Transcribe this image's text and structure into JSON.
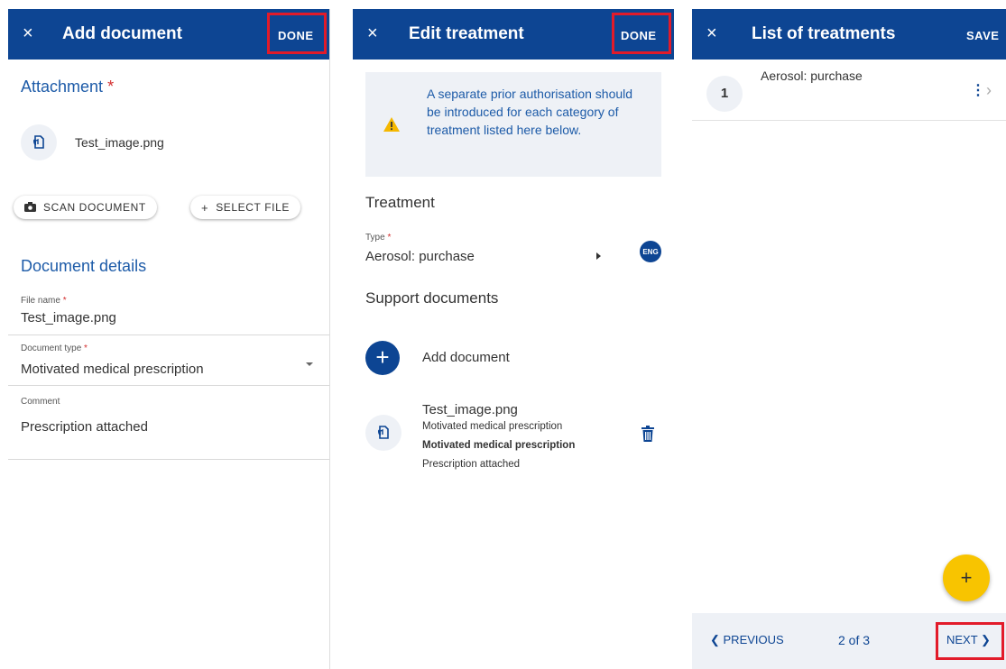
{
  "panel_add_document": {
    "title": "Add document",
    "done": "DONE",
    "attachment_heading": "Attachment",
    "required_mark": "*",
    "file_name": "Test_image.png",
    "scan_button": "SCAN DOCUMENT",
    "select_file_button": "SELECT FILE",
    "select_file_icon": "+",
    "details_heading": "Document details",
    "fields": {
      "file_name_label": "File name",
      "file_name_value": "Test_image.png",
      "document_type_label": "Document type",
      "document_type_value": "Motivated medical prescription",
      "comment_label": "Comment",
      "comment_value": "Prescription attached"
    }
  },
  "panel_edit_treatment": {
    "title": "Edit treatment",
    "done": "DONE",
    "warning": "A separate prior authorisation should be introduced for each category of treatment listed here below.",
    "treatment_heading": "Treatment",
    "type_label": "Type",
    "type_value": "Aerosol: purchase",
    "language_badge": "ENG",
    "support_heading": "Support documents",
    "add_document": "Add document",
    "add_icon": "+",
    "document": {
      "name": "Test_image.png",
      "line1": "Motivated medical prescription",
      "line2": "Motivated medical prescription",
      "line3": "Prescription attached"
    }
  },
  "panel_list_treatments": {
    "title": "List of treatments",
    "save": "SAVE",
    "items": [
      {
        "number": "1",
        "label": "Aerosol: purchase"
      }
    ],
    "kebab": "⋮",
    "chevron": "›",
    "fab": "+",
    "pagination": {
      "previous": "❮ PREVIOUS",
      "page": "2 of 3",
      "next": "NEXT ❯"
    }
  },
  "close_glyph": "×",
  "icons": {
    "close": "close-icon",
    "camera": "camera-icon",
    "hand_document": "hand-document-icon",
    "warning": "warning-icon",
    "trash": "trash-icon"
  },
  "colors": {
    "header": "#0d4593",
    "highlight": "#e21b2a",
    "fab": "#f8c400",
    "link": "#1d5ba8",
    "warning": "#f5b800"
  }
}
